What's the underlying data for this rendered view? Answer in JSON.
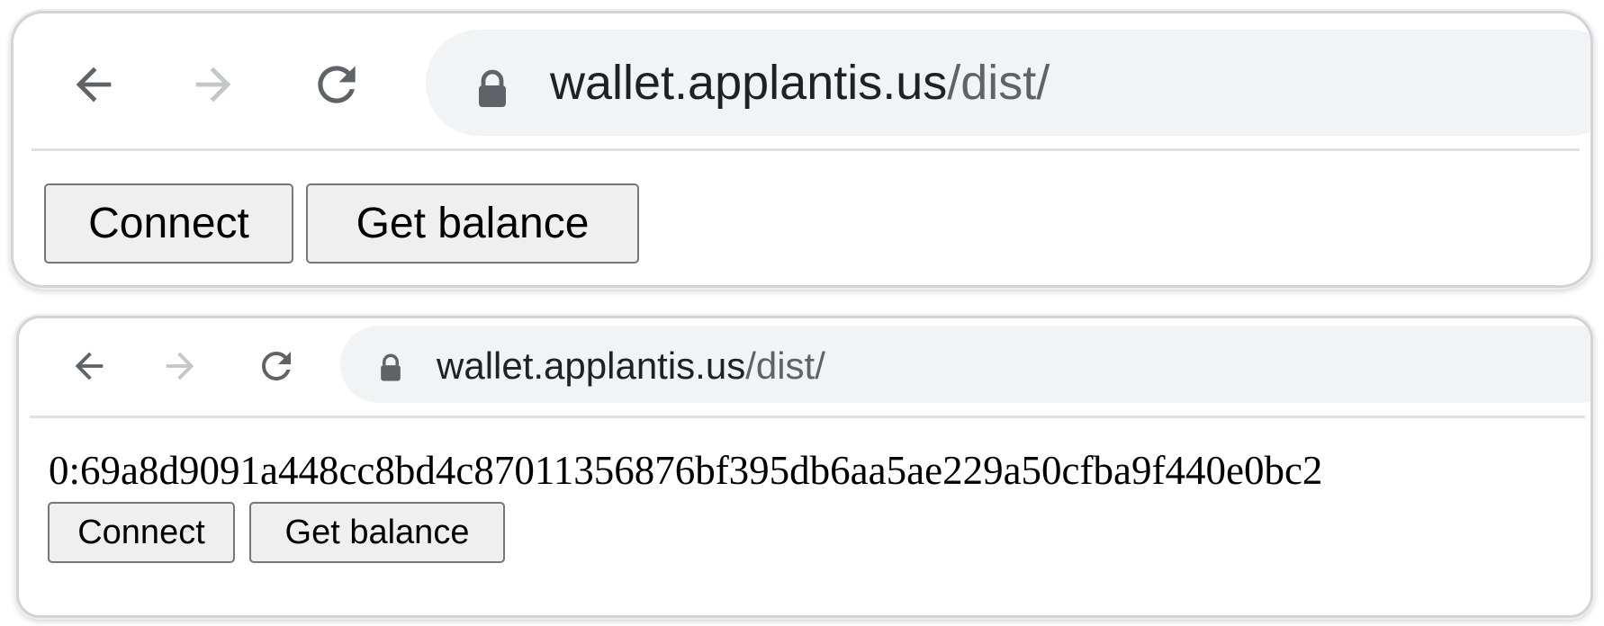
{
  "screenshots": [
    {
      "address_bar": {
        "domain": "wallet.applantis.us",
        "path": "/dist/"
      },
      "account_text": "",
      "buttons": {
        "connect": "Connect",
        "get_balance": "Get balance"
      }
    },
    {
      "address_bar": {
        "domain": "wallet.applantis.us",
        "path": "/dist/"
      },
      "account_text": "0:69a8d9091a448cc8bd4c87011356876bf395db6aa5ae229a50cfba9f440e0bc2",
      "buttons": {
        "connect": "Connect",
        "get_balance": "Get balance"
      }
    }
  ],
  "icons": {
    "back": "arrow-left-icon",
    "forward": "arrow-right-icon",
    "reload": "reload-icon",
    "lock": "lock-icon"
  },
  "colors": {
    "icon_active": "#5f6368",
    "icon_disabled": "#c4c7c9",
    "address_bar_bg": "#f1f3f4",
    "url_domain": "#202124",
    "url_path": "#5f6368",
    "button_bg": "#efefef",
    "button_border": "#767676"
  }
}
